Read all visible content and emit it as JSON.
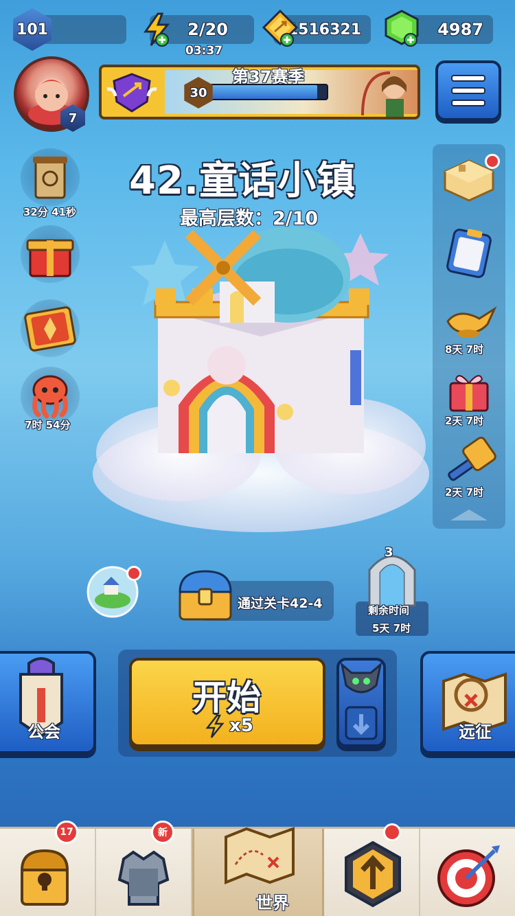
{
  "top_bar": {
    "level": "101",
    "energy": "2/20",
    "energy_timer": "03:37",
    "coins": "1516321",
    "gems": "4987"
  },
  "season": {
    "title": "第37赛季",
    "tier": "30",
    "progress": 0.92
  },
  "profile": {
    "vip_level": "7"
  },
  "stage": {
    "title": "42.童话小镇",
    "max_floor": "最高层数：2/10"
  },
  "left_side": {
    "bounty_timer": "32分 41秒",
    "octopus_timer": "7时 54分"
  },
  "right_side": {
    "lamp_timer": "8天 7时",
    "gift_timer": "2天 7时",
    "hammer_timer": "2天 7时"
  },
  "reward": {
    "chest_label": "通过关卡42-4",
    "portal_count": "3",
    "portal_remaining_label": "剩余时间",
    "portal_remaining": "5天 7时"
  },
  "actions": {
    "guild_label": "公会",
    "start_label": "开始",
    "start_cost": "x5",
    "expedition_label": "远征"
  },
  "bottom_nav": {
    "chest_badge": "17",
    "armor_badge": "新",
    "world_label": "世界"
  },
  "colors": {
    "accent_gold": "#f5c02c",
    "badge_red": "#e53b3b",
    "gem_green": "#5fd43a"
  }
}
